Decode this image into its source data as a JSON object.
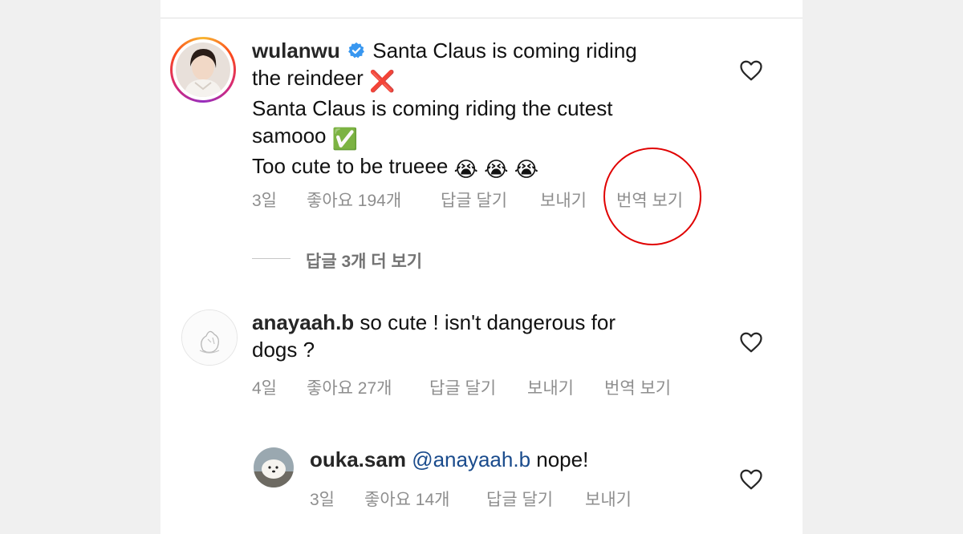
{
  "comments": [
    {
      "username": "wulanwu",
      "verified": true,
      "lines": [
        "Santa Claus is coming riding",
        "the reindeer",
        "Santa Claus is coming riding the cutest",
        "samooo",
        "Too cute to be trueee"
      ],
      "emoji": {
        "cross": "❌",
        "check": "✅",
        "cry": "😭 😭 😭"
      },
      "time": "3일",
      "likes": "좋아요 194개",
      "reply": "답글 달기",
      "send": "보내기",
      "translate": "번역 보기",
      "view_replies": "답글 3개 더 보기"
    },
    {
      "username": "anayaah.b",
      "lines": [
        "so cute ! isn't dangerous for",
        "dogs ?"
      ],
      "time": "4일",
      "likes": "좋아요 27개",
      "reply": "답글 달기",
      "send": "보내기",
      "translate": "번역 보기"
    },
    {
      "username": "ouka.sam",
      "mention": "@anayaah.b",
      "text": "nope!",
      "time": "3일",
      "likes": "좋아요 14개",
      "reply": "답글 달기",
      "send": "보내기"
    }
  ],
  "colors": {
    "annotation_circle": "#e00000",
    "verified_badge": "#3897f0",
    "mention": "#1a4b8c"
  }
}
